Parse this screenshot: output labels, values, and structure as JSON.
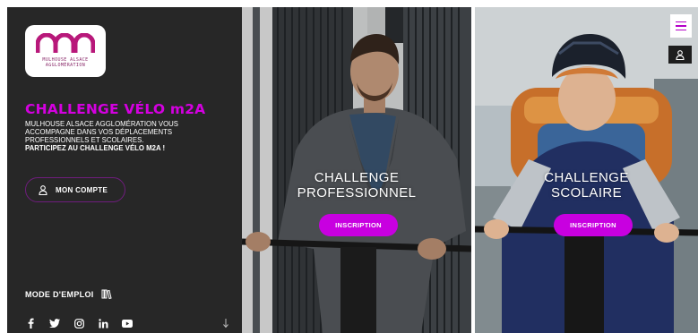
{
  "brand": {
    "logo_lines": [
      "MULHOUSE ALSACE",
      "AGGLOMÉRATION"
    ],
    "accent_color": "#d400e0",
    "button_color": "#c800e0",
    "panel_color": "#272727"
  },
  "hero": {
    "title": "CHALLENGE VÉLO m2A",
    "intro": "MULHOUSE ALSACE AGGLOMÉRATION VOUS ACCOMPAGNE DANS VOS DÉPLACEMENTS PROFESSIONNELS ET SCOLAIRES.",
    "cta": "PARTICIPEZ AU CHALLENGE VÉLO m2A !"
  },
  "account": {
    "label": "MON COMPTE",
    "icon": "user-icon"
  },
  "mode_emploi": {
    "label": "MODE D'EMPLOI",
    "icon": "book-icon"
  },
  "socials": [
    "facebook-icon",
    "twitter-icon",
    "instagram-icon",
    "linkedin-icon",
    "youtube-icon"
  ],
  "panels": {
    "pro": {
      "line1": "CHALLENGE",
      "line2": "PROFESSIONNEL",
      "button": "INSCRIPTION"
    },
    "school": {
      "line1": "CHALLENGE",
      "line2": "SCOLAIRE",
      "button": "INSCRIPTION"
    }
  },
  "controls": {
    "menu_icon": "hamburger-menu-icon",
    "user_icon": "user-icon"
  }
}
